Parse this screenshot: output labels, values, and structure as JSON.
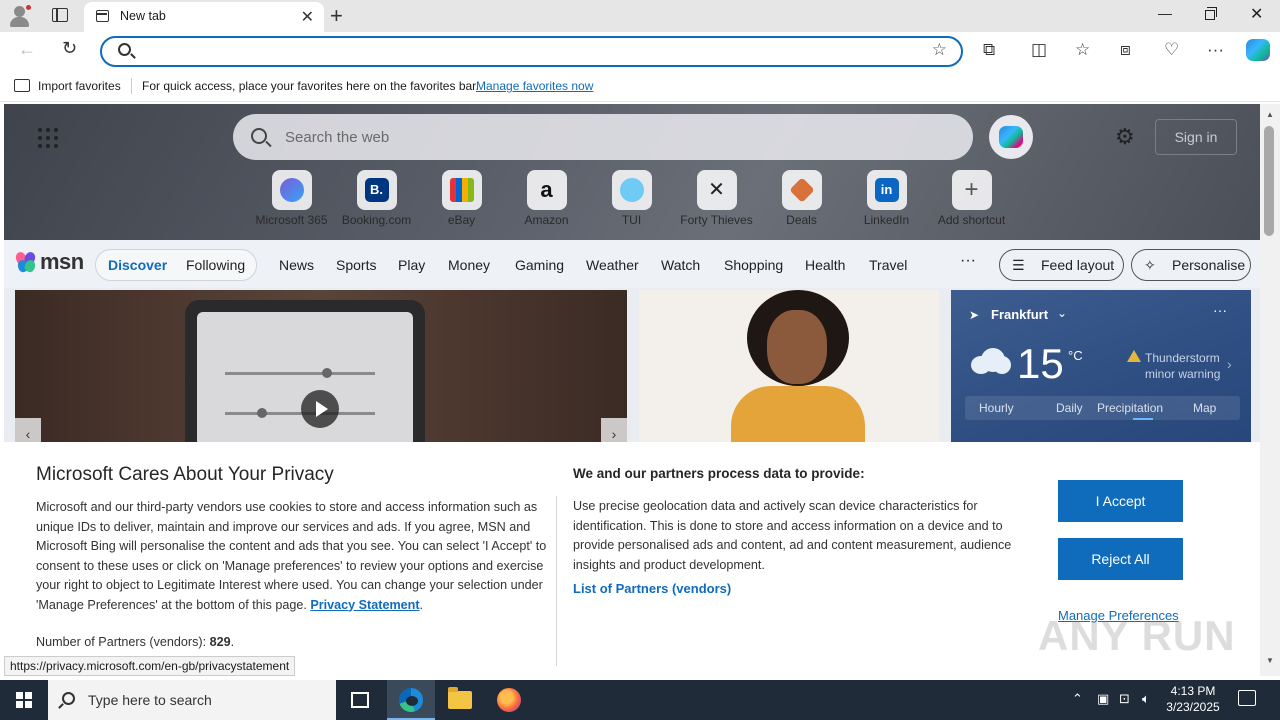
{
  "browser": {
    "tab_title": "New tab",
    "favorites_bar": {
      "import_label": "Import favorites",
      "hint": "For quick access, place your favorites here on the favorites bar.",
      "manage_link": "Manage favorites now"
    }
  },
  "ntp": {
    "search_placeholder": "Search the web",
    "sign_in": "Sign in",
    "shortcuts": [
      {
        "label": "Microsoft 365",
        "icon": "microsoft-365-icon",
        "color": "#7b5cd6"
      },
      {
        "label": "Booking.com",
        "icon": "booking-icon",
        "color": "#003580",
        "glyph": "B."
      },
      {
        "label": "eBay",
        "icon": "ebay-icon",
        "color": "#e53238"
      },
      {
        "label": "Amazon",
        "icon": "amazon-icon",
        "color": "#111111",
        "glyph": "a"
      },
      {
        "label": "TUI",
        "icon": "tui-icon",
        "color": "#70cbf4"
      },
      {
        "label": "Forty Thieves",
        "icon": "forty-thieves-icon",
        "color": "#222222"
      },
      {
        "label": "Deals",
        "icon": "deals-icon",
        "color": "#d9713b"
      },
      {
        "label": "LinkedIn",
        "icon": "linkedin-icon",
        "color": "#0a66c2",
        "glyph": "in"
      },
      {
        "label": "Add shortcut",
        "icon": "plus-icon",
        "color": "#555555",
        "glyph": "+"
      }
    ]
  },
  "msn": {
    "logo_text": "msn",
    "discover": "Discover",
    "following": "Following",
    "nav": [
      "News",
      "Sports",
      "Play",
      "Money",
      "Gaming",
      "Weather",
      "Watch",
      "Shopping",
      "Health",
      "Travel"
    ],
    "more": "···",
    "feed_layout": "Feed layout",
    "personalise": "Personalise"
  },
  "weather": {
    "city": "Frankfurt",
    "temp": "15",
    "unit": "°C",
    "warning_line1": "Thunderstorm",
    "warning_line2": "minor warning",
    "tabs": [
      "Hourly",
      "Daily",
      "Precipitation",
      "Map"
    ]
  },
  "consent": {
    "title": "Microsoft Cares About Your Privacy",
    "body": "Microsoft and our third-party vendors use cookies to store and access information such as unique IDs to deliver, maintain and improve our services and ads. If you agree, MSN and Microsoft Bing will personalise the content and ads that you see. You can select 'I Accept' to consent to these uses or click on 'Manage preferences' to review your options and exercise your right to object to Legitimate Interest where used.  You can change your selection under 'Manage Preferences' at the bottom of this page.",
    "privacy_link": "Privacy Statement",
    "period": ".",
    "partners_label": "Number of Partners (vendors):",
    "partners_count": "829",
    "partners_suffix": ".",
    "right_title": "We and our partners process data to provide:",
    "right_body": "Use precise geolocation data and actively scan device characteristics for identification. This is done to store and access information on a device and to provide personalised ads and content, ad and content measurement, audience insights and product development.",
    "vendors_link": "List of Partners (vendors)",
    "accept": "I Accept",
    "reject": "Reject All",
    "manage": "Manage Preferences",
    "watermark": "ANY RUN"
  },
  "status_url": "https://privacy.microsoft.com/en-gb/privacystatement",
  "taskbar": {
    "search_placeholder": "Type here to search",
    "time": "4:13 PM",
    "date": "3/23/2025"
  }
}
